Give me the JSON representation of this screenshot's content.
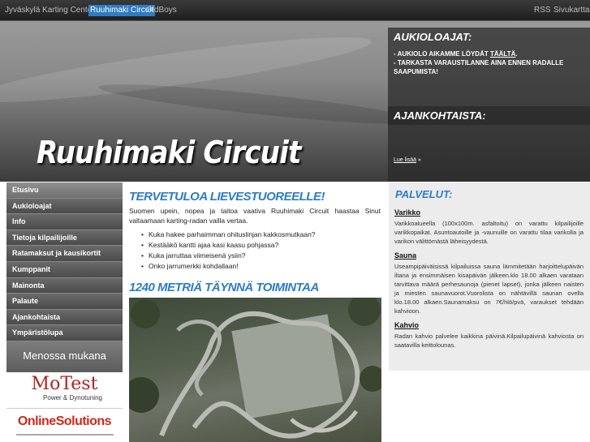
{
  "topnav": {
    "items": [
      {
        "label": "Jyväskylä Karting Center",
        "active": false
      },
      {
        "label": "Ruuhimaki Circuit",
        "active": true
      },
      {
        "label": "OldBoys",
        "active": false
      }
    ],
    "rss": "RSS",
    "sitemap": "Sivukartta"
  },
  "header": {
    "title": "Ruuhimaki Circuit",
    "box1": {
      "title": "AUKIOLOAJAT:",
      "line1_prefix": "- AUKIOLO AIKAMME LÖYDÄT ",
      "line1_link": "TÄÄLTÄ",
      "line1_suffix": ".",
      "line2": "- TARKASTA VARAUSTILANNE AINA ENNEN RADALLE SAAPUMISTA!"
    },
    "box2": {
      "title": "AJANKOHTAISTA:",
      "readmore": "Lue lisää",
      "readmore_suffix": " »"
    }
  },
  "sidebar": {
    "items": [
      "Etusivu",
      "Aukioloajat",
      "Info",
      "Tietoja kilpailijoille",
      "Ratamaksut ja kausikortit",
      "Kumppanit",
      "Mainonta",
      "Palaute",
      "Ajankohtaista",
      "Ympäristölupa"
    ],
    "menossa": "Menossa mukana",
    "ad1": {
      "brand": "MoTest",
      "tagline": "Power & Dynotuning"
    },
    "ad2": {
      "brand": "OnlineSolutions"
    }
  },
  "main": {
    "heading1": "TERVETULOA LIEVESTUOREELLE!",
    "intro": "Suomen upein, nopea ja taitoa vaativa Ruuhimaki Circuit haastaa Sinut valtaamaan karting-radan vailla vertaa.",
    "bullets": [
      "Kuka hakee parhaimman ohituslinjan kakkosmutkaan?",
      "Kestääkö kantti ajaa kasi kaasu pohjassa?",
      "Kuka jarruttaa viimeisenä ysiin?",
      "Onko jarrumerkki kohdallaan!"
    ],
    "heading2": "1240 METRIÄ TÄYNNÄ TOIMINTAA"
  },
  "right": {
    "title": "PALVELUT:",
    "sections": [
      {
        "heading": "Varikko",
        "text": "Varikkoalueella (100x100m. asfaltoitu) on varattu kilpailijoille varikkopaikat. Asuntoautoille ja -vaunuille on varattu tilaa varikolla ja varikon välittömästä läheisyydestä."
      },
      {
        "heading": "Sauna",
        "text": "Useampipäiväisissä kilpailuissa sauna lämmitetään harjoittelupäivän iltana ja ensimmäisen kisapäivän jälkeen.klo 18.00 alkaen varataan tarvittava määrä perhesaunoja (pienet lapset), jonka jälkeen naisten ja miesten saunavuorot.Vuorolista on nähtävillä saunan ovella klo.18.00 alkaen.Saunamaksu on 7€/hlö/pvä, varaukset tehdään kahvioon."
      },
      {
        "heading": "Kahvio",
        "text": "Radan kahvio palvelee kaikkina päivinä.Kilpailupäivinä kahviosta on saatavilla keittolounas."
      }
    ]
  },
  "colors": {
    "accent": "#2d7cc4",
    "nav_bg": "#2a2a2a"
  }
}
